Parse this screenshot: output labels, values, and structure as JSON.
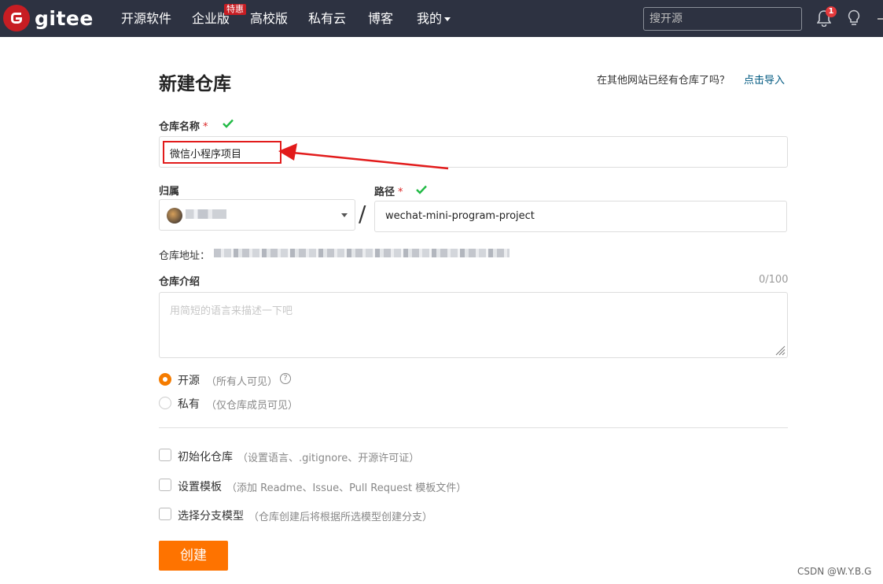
{
  "nav": {
    "logo_text": "gitee",
    "items": [
      "开源软件",
      "企业版",
      "高校版",
      "私有云",
      "博客",
      "我的"
    ],
    "badge": "特惠",
    "search_placeholder": "搜开源",
    "notification_count": "1"
  },
  "page": {
    "title": "新建仓库",
    "import_prompt": "在其他网站已经有仓库了吗？",
    "import_link": "点击导入"
  },
  "form": {
    "name_label": "仓库名称",
    "required_mark": "*",
    "name_value": "微信小程序项目",
    "owner_label": "归属",
    "path_label": "路径",
    "path_value": "wechat-mini-program-project",
    "slash": "/",
    "address_label": "仓库地址：",
    "desc_label": "仓库介绍",
    "desc_count": "0/100",
    "desc_placeholder": "用简短的语言来描述一下吧",
    "visibility": [
      {
        "label": "开源",
        "hint": "（所有人可见）",
        "selected": true
      },
      {
        "label": "私有",
        "hint": "（仅仓库成员可见）",
        "selected": false
      }
    ],
    "help_glyph": "?",
    "options": [
      {
        "label": "初始化仓库",
        "hint": "（设置语言、.gitignore、开源许可证）"
      },
      {
        "label": "设置模板",
        "hint": "（添加 Readme、Issue、Pull Request 模板文件）"
      },
      {
        "label": "选择分支模型",
        "hint": "（仓库创建后将根据所选模型创建分支）"
      }
    ],
    "submit_label": "创建"
  },
  "watermark": "CSDN @W.Y.B.G",
  "colors": {
    "nav_bg": "#2d3241",
    "brand_red": "#c71d23",
    "primary_orange": "#fe7300",
    "link_blue": "#005980",
    "success_green": "#21ba45",
    "annotation_red": "#e21b1b"
  }
}
